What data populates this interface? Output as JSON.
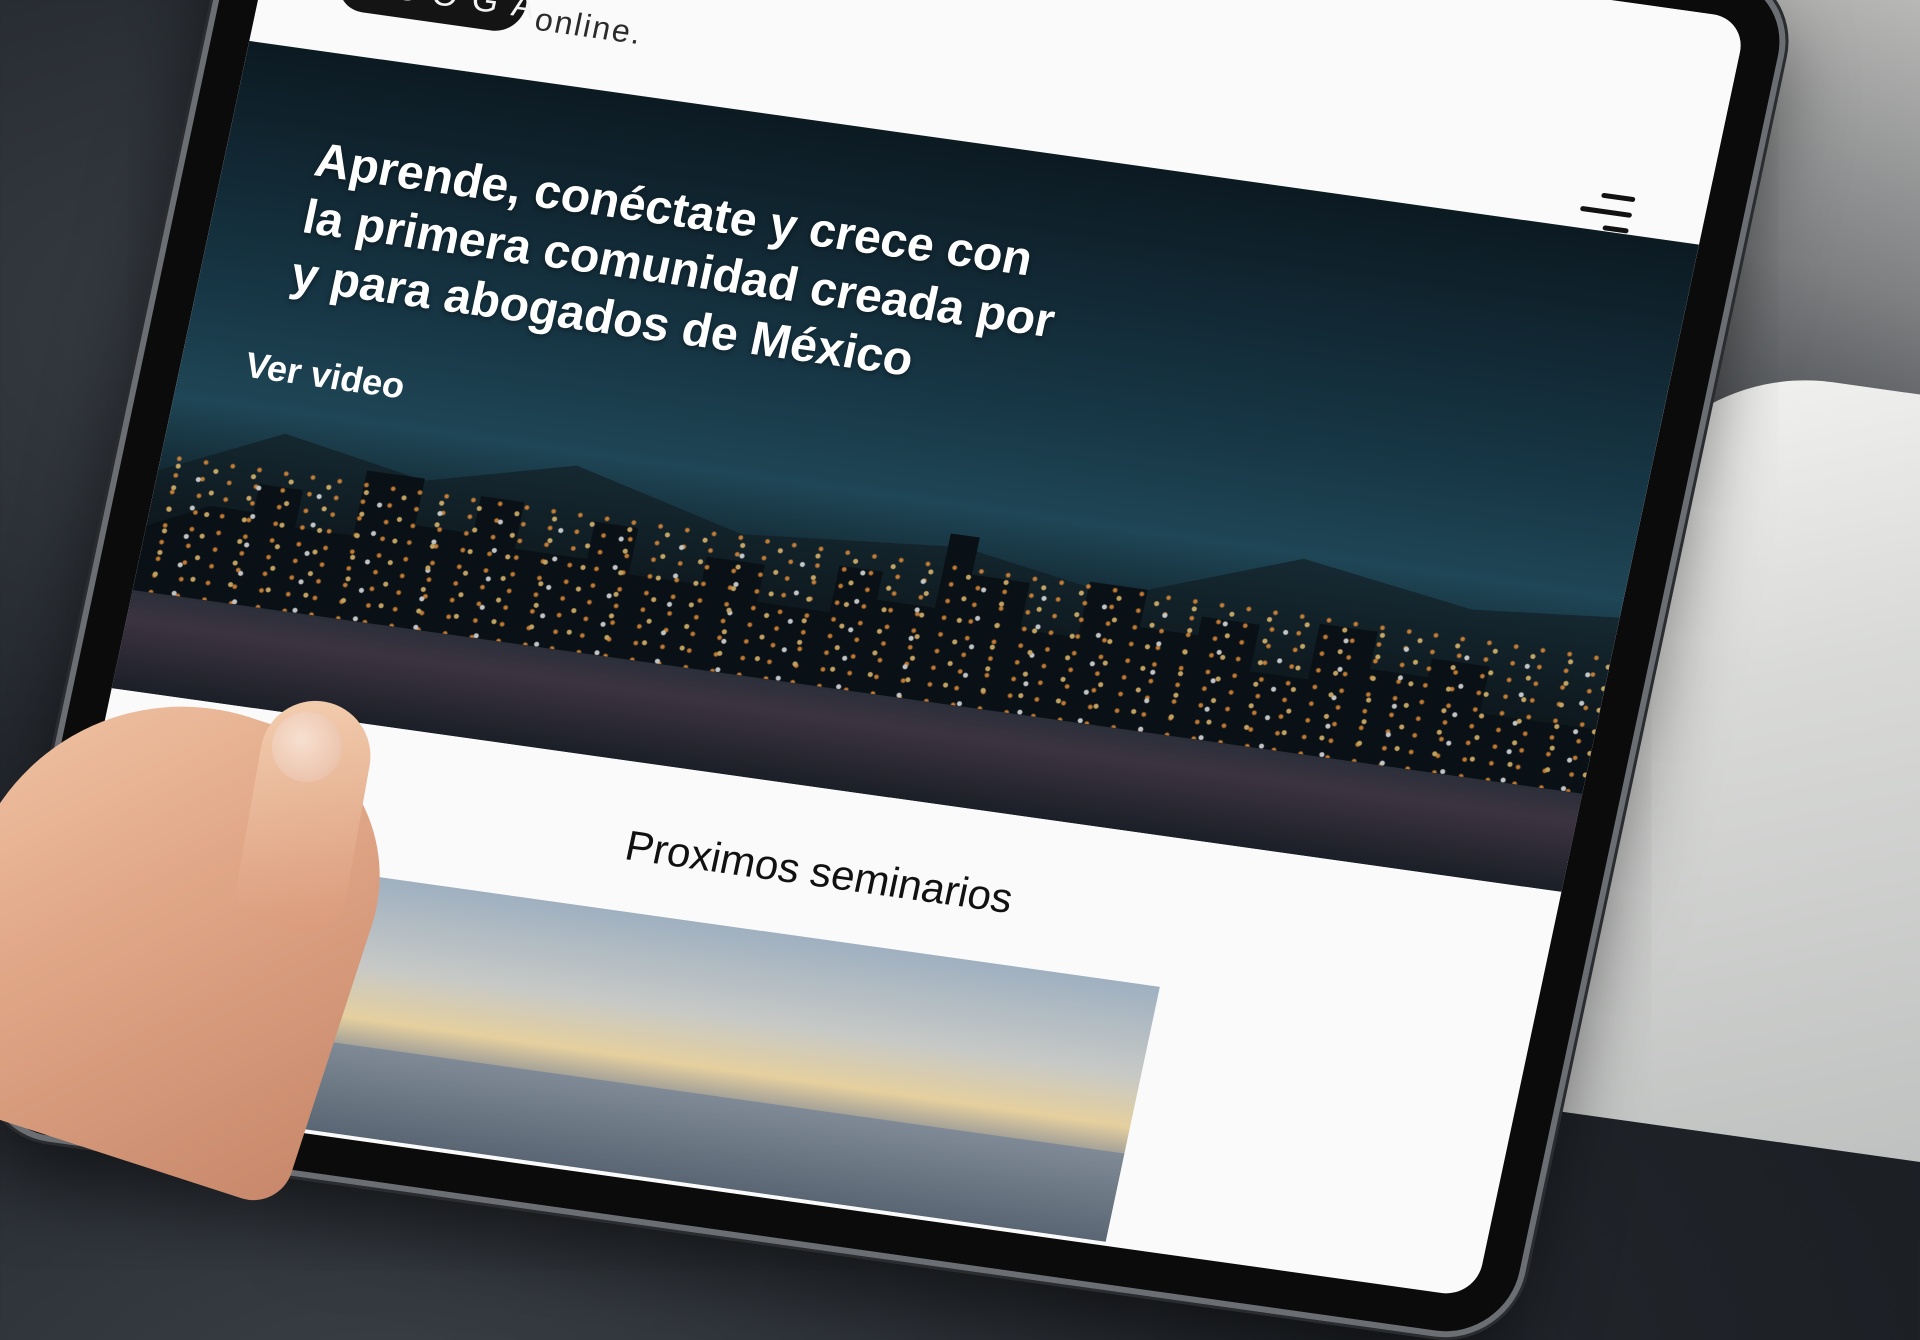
{
  "site": {
    "logo_text": "ABOGA",
    "logo_suffix": "online."
  },
  "header": {
    "menu_icon": "hamburger-menu-icon"
  },
  "hero": {
    "headline": "Aprende, conéctate y crece con la primera comunidad creada por y para abogados de México",
    "video_link": "Ver video"
  },
  "seminars": {
    "title": "Proximos seminarios"
  },
  "colors": {
    "logo_pill": "#141414",
    "hero_text": "#ffffff",
    "page_background": "#fafafa"
  }
}
